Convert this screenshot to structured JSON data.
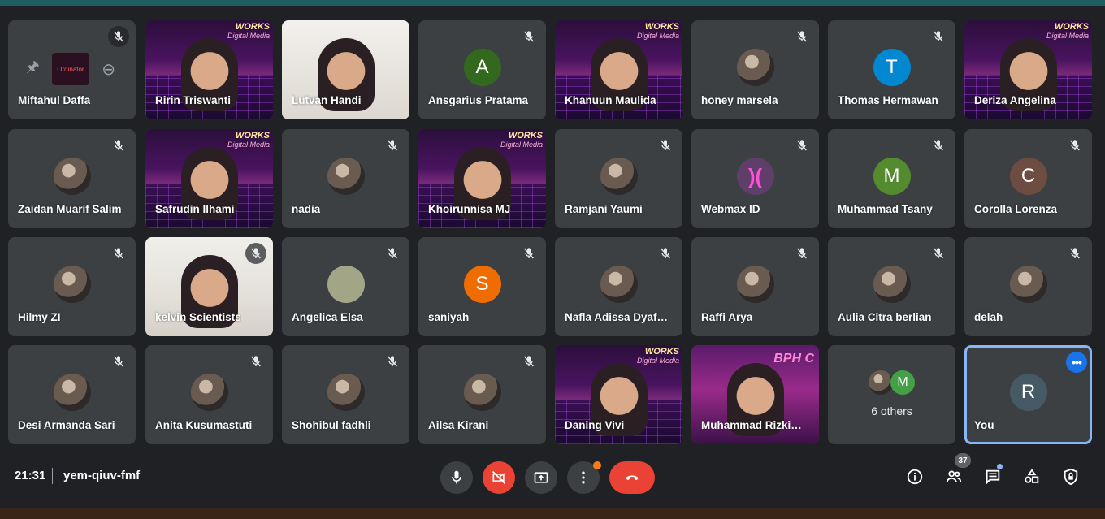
{
  "meeting": {
    "time": "21:31",
    "code": "yem-qiuv-fmf",
    "participant_count": "37"
  },
  "colors": {
    "tile_bg": "#3c4043",
    "self_outline": "#8ab4f8",
    "end_call": "#ea4335",
    "accent_blue": "#1a73e8"
  },
  "tiles": [
    {
      "name": "Miftahul Daffa",
      "kind": "pinned-presentation",
      "muted": true
    },
    {
      "name": "Ririn Triswanti",
      "kind": "video",
      "muted": false
    },
    {
      "name": "Lutvan Handi",
      "kind": "video",
      "muted": false
    },
    {
      "name": "Ansgarius Pratama",
      "kind": "letter",
      "letter": "A",
      "color": "#33691e",
      "muted": true
    },
    {
      "name": "Khanuun Maulida",
      "kind": "video",
      "muted": false
    },
    {
      "name": "honey marsela",
      "kind": "photo",
      "muted": true
    },
    {
      "name": "Thomas Hermawan",
      "kind": "letter",
      "letter": "T",
      "color": "#0288d1",
      "muted": true
    },
    {
      "name": "Deriza Angelina",
      "kind": "video",
      "muted": false
    },
    {
      "name": "Zaidan Muarif Salim",
      "kind": "photo",
      "muted": true
    },
    {
      "name": "Safrudin Ilhami",
      "kind": "video",
      "muted": false
    },
    {
      "name": "nadia",
      "kind": "photo",
      "muted": true
    },
    {
      "name": "Khoirunnisa MJ",
      "kind": "video",
      "muted": false
    },
    {
      "name": "Ramjani Yaumi",
      "kind": "photo",
      "muted": true
    },
    {
      "name": "Webmax ID",
      "kind": "logo",
      "muted": true
    },
    {
      "name": "Muhammad Tsany",
      "kind": "letter",
      "letter": "M",
      "color": "#558b2f",
      "muted": true
    },
    {
      "name": "Corolla Lorenza",
      "kind": "letter",
      "letter": "C",
      "color": "#6d4c41",
      "muted": true
    },
    {
      "name": "Hilmy ZI",
      "kind": "photo",
      "muted": true
    },
    {
      "name": "kelvin Scientists",
      "kind": "video",
      "muted": true
    },
    {
      "name": "Angelica Elsa",
      "kind": "plain",
      "color": "#a3a686",
      "muted": true
    },
    {
      "name": "saniyah",
      "kind": "letter",
      "letter": "S",
      "color": "#ef6c00",
      "muted": true
    },
    {
      "name": "Nafla Adissa Dyaf…",
      "kind": "photo",
      "muted": true
    },
    {
      "name": "Raffi Arya",
      "kind": "photo",
      "muted": true
    },
    {
      "name": "Aulia Citra berlian",
      "kind": "photo",
      "muted": true
    },
    {
      "name": "delah",
      "kind": "photo",
      "muted": true
    },
    {
      "name": "Desi Armanda Sari",
      "kind": "photo",
      "muted": true
    },
    {
      "name": "Anita Kusumastuti",
      "kind": "photo",
      "muted": true
    },
    {
      "name": "Shohibul fadhli",
      "kind": "photo",
      "muted": true
    },
    {
      "name": "Ailsa Kirani",
      "kind": "photo",
      "muted": true
    },
    {
      "name": "Daning Vivi",
      "kind": "video",
      "muted": false
    },
    {
      "name": "Muhammad Rizki…",
      "kind": "video-purple",
      "muted": false
    },
    {
      "name": "",
      "kind": "others",
      "label": "6 others",
      "letter": "M",
      "muted": false
    },
    {
      "name": "You",
      "kind": "self",
      "letter": "R",
      "color": "#455a64",
      "muted": false
    }
  ],
  "overlays": {
    "works_title": "WORKS",
    "works_sub": "Digital Media",
    "bph_text": "BPH C",
    "presentation_thumb": "Ordinator"
  },
  "icons": {
    "mic_off": "mic-off-icon",
    "mic": "mic-icon",
    "camera_off": "camera-off-icon",
    "present": "present-icon",
    "more": "more-options-icon",
    "end_call": "end-call-icon",
    "info": "info-icon",
    "people": "people-icon",
    "chat": "chat-icon",
    "activities": "activities-icon",
    "host": "host-controls-icon"
  }
}
